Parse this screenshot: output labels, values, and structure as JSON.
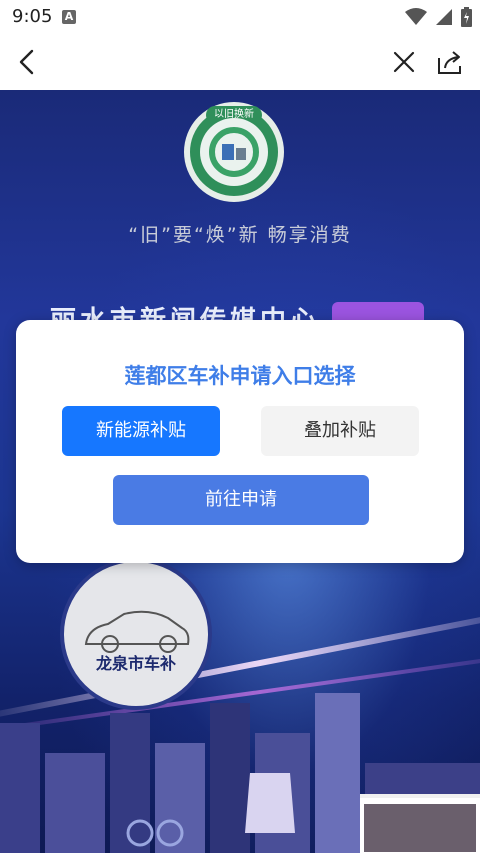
{
  "status_bar": {
    "time": "9:05",
    "notification_icon": "A"
  },
  "toolbar": {
    "back_icon": "chevron-left-icon",
    "close_icon": "close-icon",
    "share_icon": "share-icon"
  },
  "poster": {
    "badge_text": "以旧换新",
    "slogan": "“旧”要“焕”新   畅享消费",
    "headline": "丽水市新闻传媒中心",
    "car_caption": "龙泉市车补"
  },
  "dialog": {
    "title": "莲都区车补申请入口选择",
    "option_primary": "新能源补贴",
    "option_secondary": "叠加补贴",
    "submit": "前往申请"
  },
  "colors": {
    "accent": "#1677ff",
    "dialog_title": "#3f7ee8",
    "submit_bg": "#4a7be4",
    "hero_bg": "#1f3494"
  }
}
